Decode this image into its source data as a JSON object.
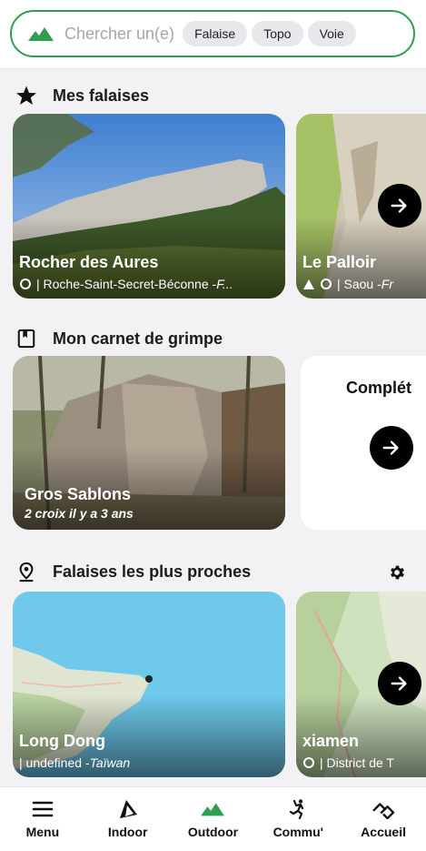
{
  "search": {
    "placeholder": "Chercher un(e)",
    "chips": [
      "Falaise",
      "Topo",
      "Voie"
    ]
  },
  "sections": {
    "favorites": {
      "title": "Mes falaises",
      "cards": [
        {
          "name": "Rocher des Aures",
          "location": "| Roche-Saint-Secret-Béconne - ",
          "country": "F..."
        },
        {
          "name": "Le Palloir",
          "location": "| Saou - ",
          "country": "Fr"
        }
      ]
    },
    "logbook": {
      "title": "Mon carnet de grimpe",
      "card": {
        "name": "Gros Sablons",
        "detail": "2 croix il y a 3 ans"
      },
      "complete_label": "Complét"
    },
    "nearby": {
      "title": "Falaises les plus proches",
      "cards": [
        {
          "name": "Long Dong",
          "location": "| undefined - ",
          "country": "Taïwan"
        },
        {
          "name": "xiamen",
          "location": "| District de T",
          "country": ""
        }
      ]
    }
  },
  "nav": [
    {
      "label": "Menu",
      "icon": "menu-icon"
    },
    {
      "label": "Indoor",
      "icon": "indoor-icon"
    },
    {
      "label": "Outdoor",
      "icon": "mountain-icon"
    },
    {
      "label": "Commu'",
      "icon": "community-icon"
    },
    {
      "label": "Accueil",
      "icon": "home-icon"
    }
  ],
  "colors": {
    "accent": "#2f9e4f",
    "background": "#f2f2f4"
  }
}
